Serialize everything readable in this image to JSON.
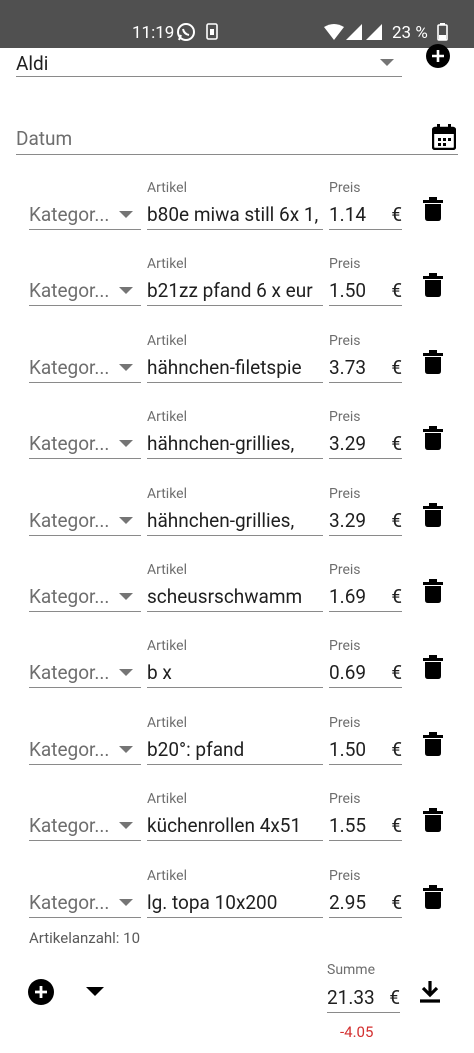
{
  "status_bar": {
    "time": "11:19",
    "battery": "23 %",
    "icons": [
      "whatsapp-icon",
      "sim-icon",
      "wifi-icon",
      "signal-icon",
      "signal-icon",
      "battery-icon"
    ]
  },
  "form": {
    "store": {
      "value": "Aldi",
      "add_icon": "plus-circle-icon"
    },
    "date": {
      "placeholder": "Datum",
      "icon": "calendar-icon"
    }
  },
  "labels": {
    "category_placeholder": "Kategor...",
    "article": "Artikel",
    "price": "Preis",
    "currency": "€"
  },
  "items": [
    {
      "category": "Kategor...",
      "article": "b80e miwa still 6x 1,",
      "price": "1.14"
    },
    {
      "category": "Kategor...",
      "article": "b21zz pfand 6 x eur",
      "price": "1.50"
    },
    {
      "category": "Kategor...",
      "article": "hähnchen-filetspie",
      "price": "3.73"
    },
    {
      "category": "Kategor...",
      "article": "hähnchen-grillies,",
      "price": "3.29"
    },
    {
      "category": "Kategor...",
      "article": "hähnchen-grillies,",
      "price": "3.29"
    },
    {
      "category": "Kategor...",
      "article": "scheusrschwamm",
      "price": "1.69"
    },
    {
      "category": "Kategor...",
      "article": "b x",
      "price": "0.69"
    },
    {
      "category": "Kategor...",
      "article": "b20°: pfand",
      "price": "1.50"
    },
    {
      "category": "Kategor...",
      "article": "küchenrollen 4x51",
      "price": "1.55"
    },
    {
      "category": "Kategor...",
      "article": "lg. topa 10x200",
      "price": "2.95"
    }
  ],
  "footer": {
    "count": "Artikelanzahl: 10",
    "sum_label": "Summe",
    "sum": "21.33",
    "currency": "€",
    "difference": "-4.05"
  },
  "colors": {
    "status_bar": "#505050",
    "difference": "#d32f2f",
    "icon": "#000000"
  }
}
